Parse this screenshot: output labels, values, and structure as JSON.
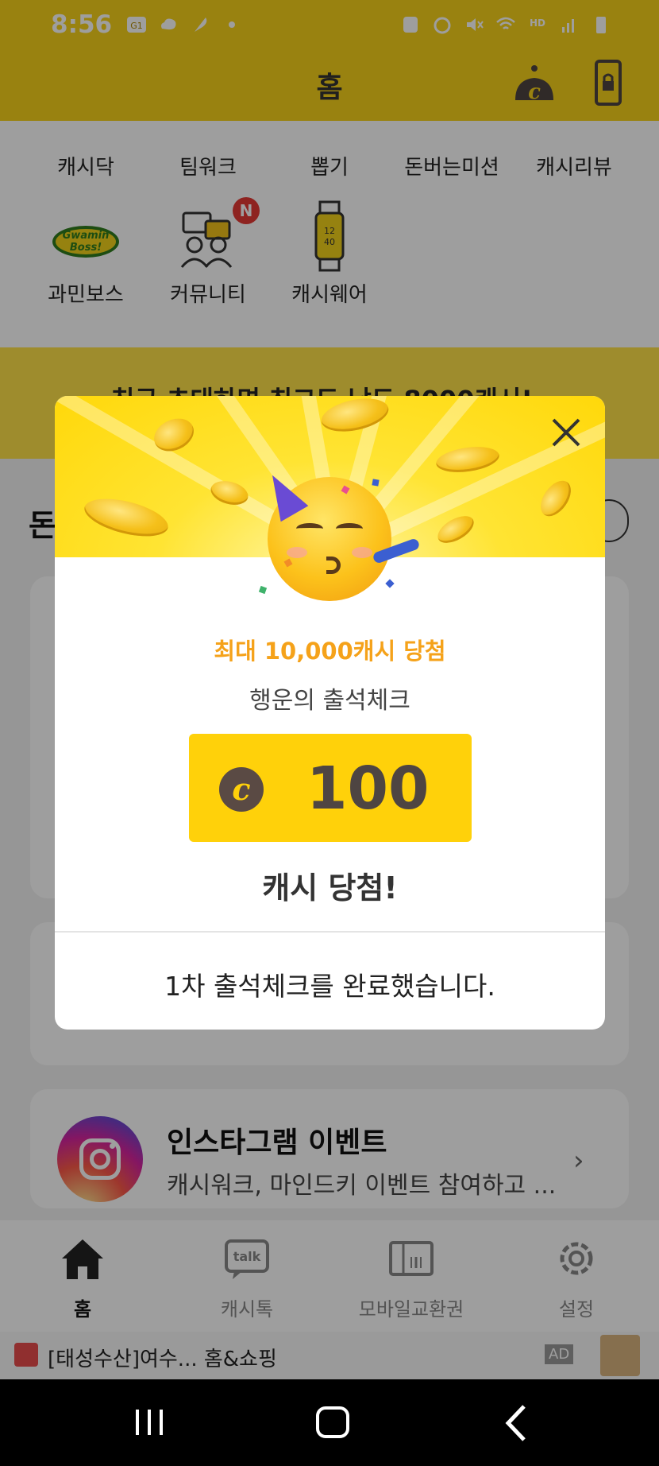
{
  "status_bar": {
    "time": "8:56",
    "left_icons": [
      "g1-icon",
      "cloud-icon",
      "feather-icon",
      "dot-icon"
    ],
    "right_icons": [
      "recycle-icon",
      "alarm-icon",
      "mute-icon",
      "wifi-icon",
      "hd-voice-icon",
      "signal-icon",
      "battery-icon"
    ]
  },
  "header": {
    "title": "홈",
    "icons": [
      "cash-coin-icon",
      "lock-screen-icon"
    ]
  },
  "menu": {
    "row1": [
      "캐시닥",
      "팀워크",
      "뽑기",
      "돈버는미션",
      "캐시리뷰"
    ],
    "row2": [
      "과민보스",
      "커뮤니티",
      "캐시웨어"
    ],
    "community_badge": "N",
    "gwamin_logo_text": "Gwamin Boss!",
    "watch_time": "12\n40"
  },
  "banner": {
    "text": "친구 초대하면 최고도 남도 8000캐시!"
  },
  "section": {
    "title": "돈"
  },
  "instagram": {
    "title": "인스타그램 이벤트",
    "subtitle": "캐시워크, 마인드키 이벤트 참여하고 ..."
  },
  "bottom_nav": {
    "items": [
      {
        "label": "홈",
        "icon": "home-icon",
        "active": true
      },
      {
        "label": "캐시톡",
        "icon": "talk-icon",
        "active": false
      },
      {
        "label": "모바일교환권",
        "icon": "gift-voucher-icon",
        "active": false
      },
      {
        "label": "설정",
        "icon": "gear-icon",
        "active": false
      }
    ],
    "talk_icon_text": "talk"
  },
  "ad": {
    "text": "[태성수산]여수...  홈&쇼핑",
    "badge": "AD"
  },
  "modal": {
    "subtitle": "최대 10,000캐시 당첨",
    "title": "행운의 출석체크",
    "currency_symbol": "c",
    "amount": "100",
    "result": "캐시 당첨!",
    "footer": "1차 출석체크를 완료했습니다."
  },
  "colors": {
    "brand_yellow": "#f7d21a",
    "amount_box": "#ffd10a",
    "subtitle_orange": "#f5a21a",
    "amount_text": "#4e4542"
  }
}
